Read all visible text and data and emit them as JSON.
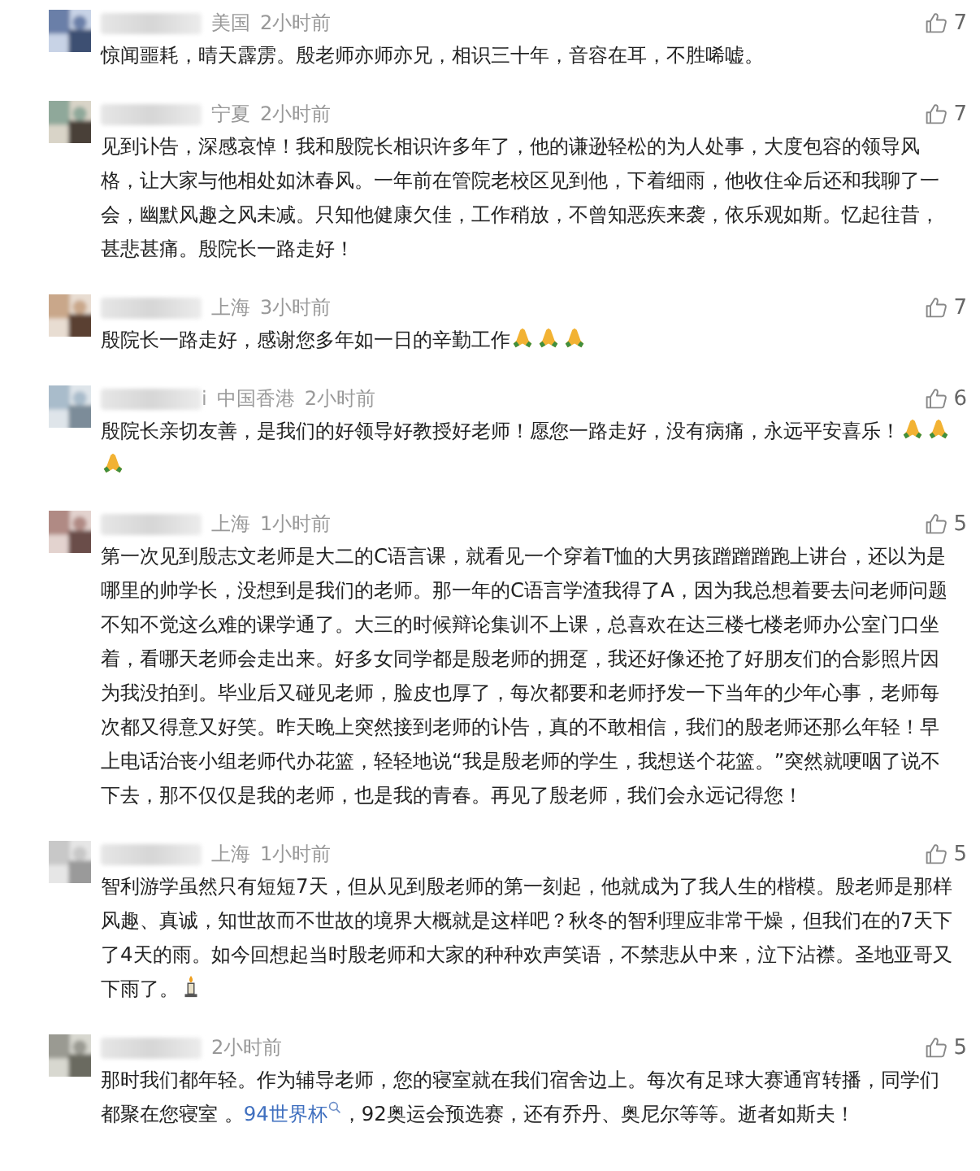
{
  "comments": [
    {
      "avatar": {
        "kind": "picture"
      },
      "name_hidden": true,
      "location": "美国",
      "time": "2小时前",
      "likes": "7",
      "body": [
        {
          "kind": "text",
          "text": "惊闻噩耗，晴天霹雳。殷老师亦师亦兄，相识三十年，音容在耳，不胜唏嘘。"
        }
      ]
    },
    {
      "avatar": {
        "kind": "picture"
      },
      "name_hidden": true,
      "location": "宁夏",
      "time": "2小时前",
      "likes": "7",
      "body": [
        {
          "kind": "text",
          "text": "见到讣告，深感哀悼！我和殷院长相识许多年了，他的谦逊轻松的为人处事，大度包容的领导风格，让大家与他相处如沐春风。一年前在管院老校区见到他，下着细雨，他收住伞后还和我聊了一会，幽默风趣之风未减。只知他健康欠佳，工作稍放，不曾知恶疾来袭，依乐观如斯。忆起往昔，甚悲甚痛。殷院长一路走好！"
        }
      ]
    },
    {
      "avatar": {
        "kind": "picture"
      },
      "name_hidden": true,
      "location": "上海",
      "time": "3小时前",
      "likes": "7",
      "body": [
        {
          "kind": "text",
          "text": "殷院长一路走好，感谢您多年如一日的辛勤工作"
        },
        {
          "kind": "pray-emoji"
        },
        {
          "kind": "pray-emoji"
        },
        {
          "kind": "pray-emoji"
        }
      ]
    },
    {
      "avatar": {
        "kind": "picture"
      },
      "name_hidden": true,
      "name_tail": "i",
      "location": "中国香港",
      "time": "2小时前",
      "likes": "6",
      "body": [
        {
          "kind": "text",
          "text": "殷院长亲切友善，是我们的好领导好教授好老师！愿您一路走好，没有病痛，永远平安喜乐！"
        },
        {
          "kind": "pray-emoji"
        },
        {
          "kind": "pray-emoji"
        },
        {
          "kind": "pray-emoji"
        }
      ]
    },
    {
      "avatar": {
        "kind": "picture"
      },
      "name_hidden": true,
      "location": "上海",
      "time": "1小时前",
      "likes": "5",
      "body": [
        {
          "kind": "text",
          "text": "第一次见到殷志文老师是大二的C语言课，就看见一个穿着T恤的大男孩蹭蹭蹭跑上讲台，还以为是哪里的帅学长，没想到是我们的老师。那一年的C语言学渣我得了A，因为我总想着要去问老师问题不知不觉这么难的课学通了。大三的时候辩论集训不上课，总喜欢在达三楼七楼老师办公室门口坐着，看哪天老师会走出来。好多女同学都是殷老师的拥趸，我还好像还抢了好朋友们的合影照片因为我没拍到。毕业后又碰见老师，脸皮也厚了，每次都要和老师抒发一下当年的少年心事，老师每次都又得意又好笑。昨天晚上突然接到老师的讣告，真的不敢相信，我们的殷老师还那么年轻！早上电话治丧小组老师代办花篮，轻轻地说“我是殷老师的学生，我想送个花篮。”突然就哽咽了说不下去，那不仅仅是我的老师，也是我的青春。再见了殷老师，我们会永远记得您！"
        }
      ]
    },
    {
      "avatar": {
        "kind": "picture"
      },
      "name_hidden": true,
      "location": "上海",
      "time": "1小时前",
      "likes": "5",
      "body": [
        {
          "kind": "text",
          "text": "智利游学虽然只有短短7天，但从见到殷老师的第一刻起，他就成为了我人生的楷模。殷老师是那样风趣、真诚，知世故而不世故的境界大概就是这样吧？秋冬的智利理应非常干燥，但我们在的7天下了4天的雨。如今回想起当时殷老师和大家的种种欢声笑语，不禁悲从中来，泣下沾襟。圣地亚哥又下雨了。"
        },
        {
          "kind": "candle-emoji"
        }
      ]
    },
    {
      "avatar": {
        "kind": "picture"
      },
      "name_hidden": true,
      "time": "2小时前",
      "likes": "5",
      "body": [
        {
          "kind": "text",
          "text": "那时我们都年轻。作为辅导老师，您的寝室就在我们宿舍边上。每次有足球大赛通宵转播，同学们都聚在您寝室 。"
        },
        {
          "kind": "link",
          "text": "94世界杯"
        },
        {
          "kind": "text",
          "text": "，92奥运会预选赛，还有乔丹、奥尼尔等等。逝者如斯夫！"
        }
      ]
    }
  ]
}
